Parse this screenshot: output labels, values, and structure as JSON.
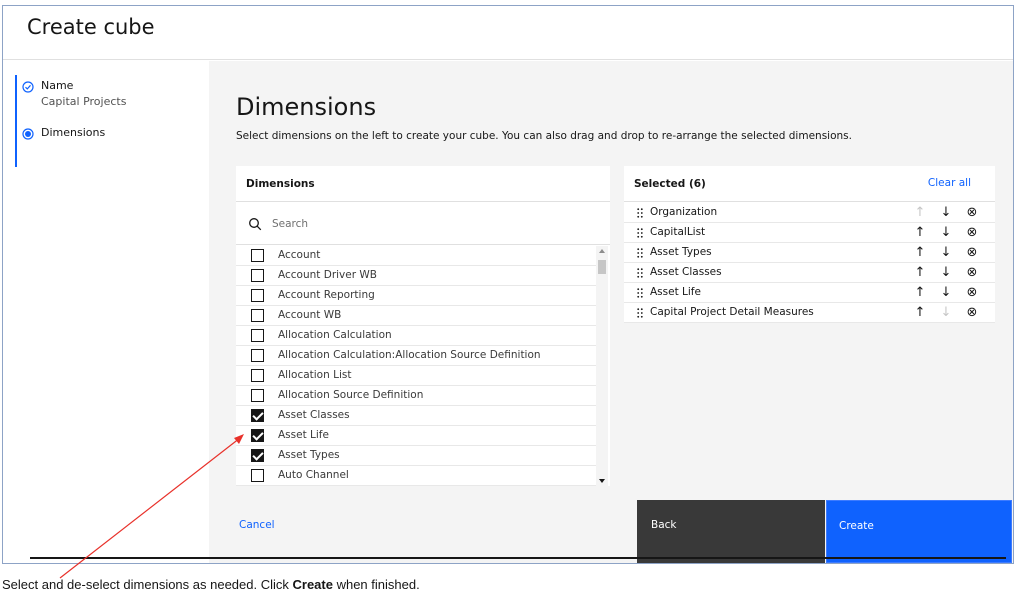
{
  "header": {
    "title": "Create cube"
  },
  "steps": [
    {
      "label": "Name",
      "sub": "Capital Projects",
      "state": "complete"
    },
    {
      "label": "Dimensions",
      "sub": "",
      "state": "current"
    }
  ],
  "main": {
    "title": "Dimensions",
    "description": "Select dimensions on the left to create your cube. You can also drag and drop to re-arrange the selected dimensions."
  },
  "dimensions_panel": {
    "title": "Dimensions",
    "search_placeholder": "Search",
    "items": [
      {
        "label": "Account",
        "checked": false
      },
      {
        "label": "Account Driver WB",
        "checked": false
      },
      {
        "label": "Account Reporting",
        "checked": false
      },
      {
        "label": "Account WB",
        "checked": false
      },
      {
        "label": "Allocation Calculation",
        "checked": false
      },
      {
        "label": "Allocation Calculation:Allocation Source Definition",
        "checked": false
      },
      {
        "label": "Allocation List",
        "checked": false
      },
      {
        "label": "Allocation Source Definition",
        "checked": false
      },
      {
        "label": "Asset Classes",
        "checked": true
      },
      {
        "label": "Asset Life",
        "checked": true
      },
      {
        "label": "Asset Types",
        "checked": true
      },
      {
        "label": "Auto Channel",
        "checked": false
      }
    ]
  },
  "selected_panel": {
    "title": "Selected (6)",
    "clear_all": "Clear all",
    "items": [
      {
        "label": "Organization",
        "up_enabled": false,
        "down_enabled": true
      },
      {
        "label": "CapitalList",
        "up_enabled": true,
        "down_enabled": true
      },
      {
        "label": "Asset Types",
        "up_enabled": true,
        "down_enabled": true
      },
      {
        "label": "Asset Classes",
        "up_enabled": true,
        "down_enabled": true
      },
      {
        "label": "Asset Life",
        "up_enabled": true,
        "down_enabled": true
      },
      {
        "label": "Capital Project Detail Measures",
        "up_enabled": true,
        "down_enabled": false
      }
    ]
  },
  "footer": {
    "cancel": "Cancel",
    "back": "Back",
    "create": "Create"
  },
  "caption": {
    "before": "Select and de-select dimensions as needed. Click ",
    "bold": "Create",
    "after": " when finished."
  },
  "colors": {
    "accent": "#0f62fe",
    "annotation_arrow": "#e8312a"
  }
}
